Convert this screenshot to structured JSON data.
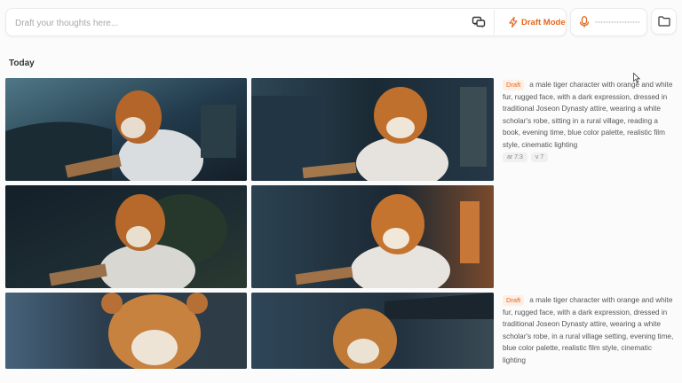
{
  "prompt_bar": {
    "placeholder": "Draft your thoughts here...",
    "draft_mode_label": "Draft Mode"
  },
  "icons": {
    "chat": "chat-bubbles-icon",
    "bolt": "bolt-icon",
    "mic": "microphone-icon",
    "folder": "folder-icon"
  },
  "section": {
    "title": "Today"
  },
  "jobs": [
    {
      "badge": "Draft",
      "prompt": "a male tiger character with orange and white fur, rugged face, with a dark expression, dressed in traditional Joseon Dynasty attire, wearing a white scholar's robe, sitting in a rural village, reading a book, evening time, blue color palette, realistic film style, cinematic lighting",
      "tags": [
        "ar 7:3",
        "v 7"
      ]
    },
    {
      "badge": "Draft",
      "prompt": "a male tiger character with orange and white fur, rugged face, with a dark expression, dressed in traditional Joseon Dynasty attire, wearing a white scholar's robe, in a rural village setting, evening time, blue color palette, realistic film style, cinematic lighting"
    }
  ],
  "colors": {
    "accent": "#e5661f",
    "badge_bg": "#fdefe4"
  }
}
